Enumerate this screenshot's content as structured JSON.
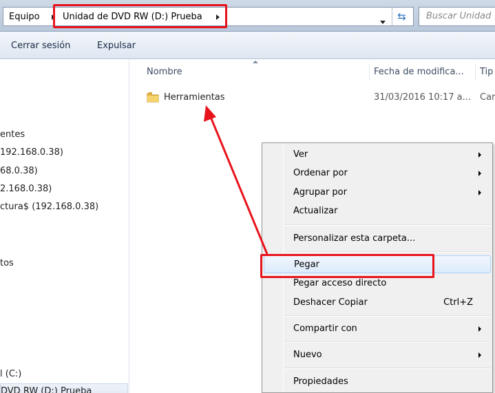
{
  "address_bar": {
    "crumbs": [
      "Equipo",
      "Unidad de DVD RW (D:) Prueba"
    ],
    "refresh_glyph": "⇆",
    "search_placeholder": "Buscar Unidad"
  },
  "toolbar": {
    "logout_label": "Cerrar sesión",
    "eject_label": "Expulsar"
  },
  "nav_pane": {
    "items": [
      "entes",
      "192.168.0.38)",
      "68.0.38)",
      "2.168.0.38)",
      "ctura$ (192.168.0.38)",
      "tos",
      "l (C:)",
      "DVD RW (D:) Prueba"
    ]
  },
  "file_list": {
    "columns": [
      "Nombre",
      "Fecha de modifica...",
      "Tip"
    ],
    "rows": [
      {
        "name": "Herramientas",
        "date": "31/03/2016 10:17 a...",
        "type": "Car",
        "icon": "folder-icon"
      }
    ]
  },
  "context_menu": {
    "items": [
      {
        "label": "Ver",
        "submenu": true
      },
      {
        "label": "Ordenar por",
        "submenu": true
      },
      {
        "label": "Agrupar por",
        "submenu": true
      },
      {
        "label": "Actualizar",
        "submenu": false
      },
      {
        "label": "Personalizar esta carpeta...",
        "submenu": false
      },
      {
        "label": "Pegar",
        "submenu": false,
        "highlighted": true
      },
      {
        "label": "Pegar acceso directo",
        "submenu": false
      },
      {
        "label": "Deshacer Copiar",
        "shortcut": "Ctrl+Z",
        "submenu": false
      },
      {
        "label": "Compartir con",
        "submenu": true
      },
      {
        "label": "Nuevo",
        "submenu": true
      },
      {
        "label": "Propiedades",
        "submenu": false
      }
    ]
  },
  "colors": {
    "annotation_red": "#e8121b",
    "menu_bg": "#f0f0f0",
    "hover_bg": "#dcebfc"
  }
}
